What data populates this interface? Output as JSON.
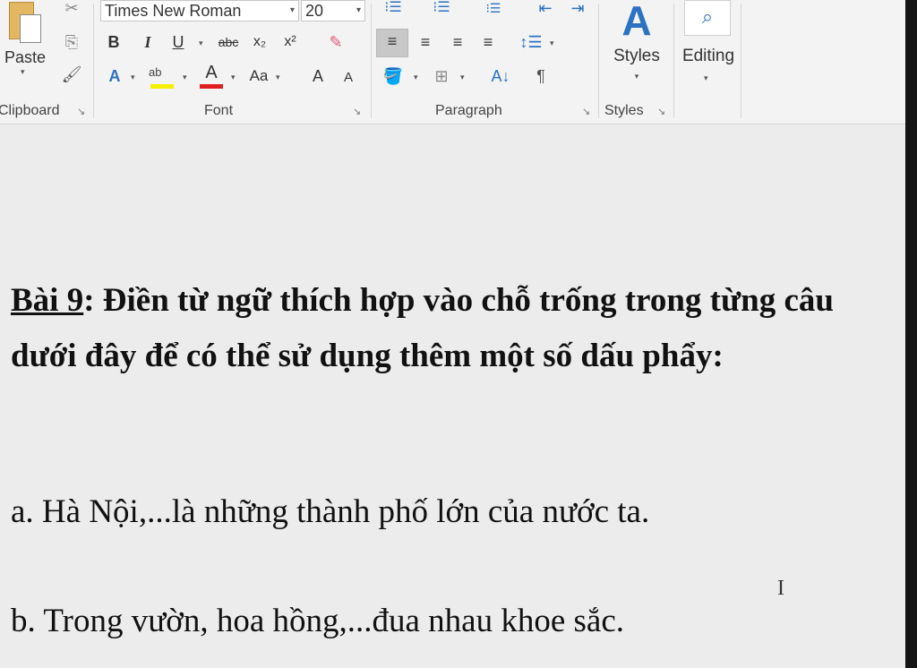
{
  "ribbon": {
    "clipboard": {
      "paste_label": "Paste",
      "group_label": "Clipboard"
    },
    "font": {
      "font_name": "Times New Roman",
      "font_size": "20",
      "bold": "B",
      "italic": "I",
      "underline": "U",
      "strikethrough": "abc",
      "subscript": "x₂",
      "superscript": "x²",
      "text_effects": "A",
      "highlight": "ab",
      "font_color": "A",
      "change_case": "Aa",
      "grow_font": "A",
      "shrink_font": "A",
      "group_label": "Font"
    },
    "paragraph": {
      "pilcrow": "¶",
      "group_label": "Paragraph"
    },
    "styles": {
      "styles_label": "Styles",
      "group_label": "Styles"
    },
    "editing": {
      "editing_label": "Editing"
    }
  },
  "document": {
    "heading_number": "Bài 9",
    "heading_text": ": Điền từ ngữ thích hợp vào chỗ trống trong từng câu dưới đây để có thể sử dụng thêm một số dấu phẩy:",
    "line_a": "a. Hà Nội,...là những thành phố lớn của nước ta.",
    "line_b": "b. Trong vườn, hoa hồng,...đua nhau khoe sắc."
  },
  "cursor": "I",
  "colors": {
    "font_color_bar": "#e02020",
    "highlight_bar": "#f5f000",
    "accent_blue": "#2b72c2"
  }
}
